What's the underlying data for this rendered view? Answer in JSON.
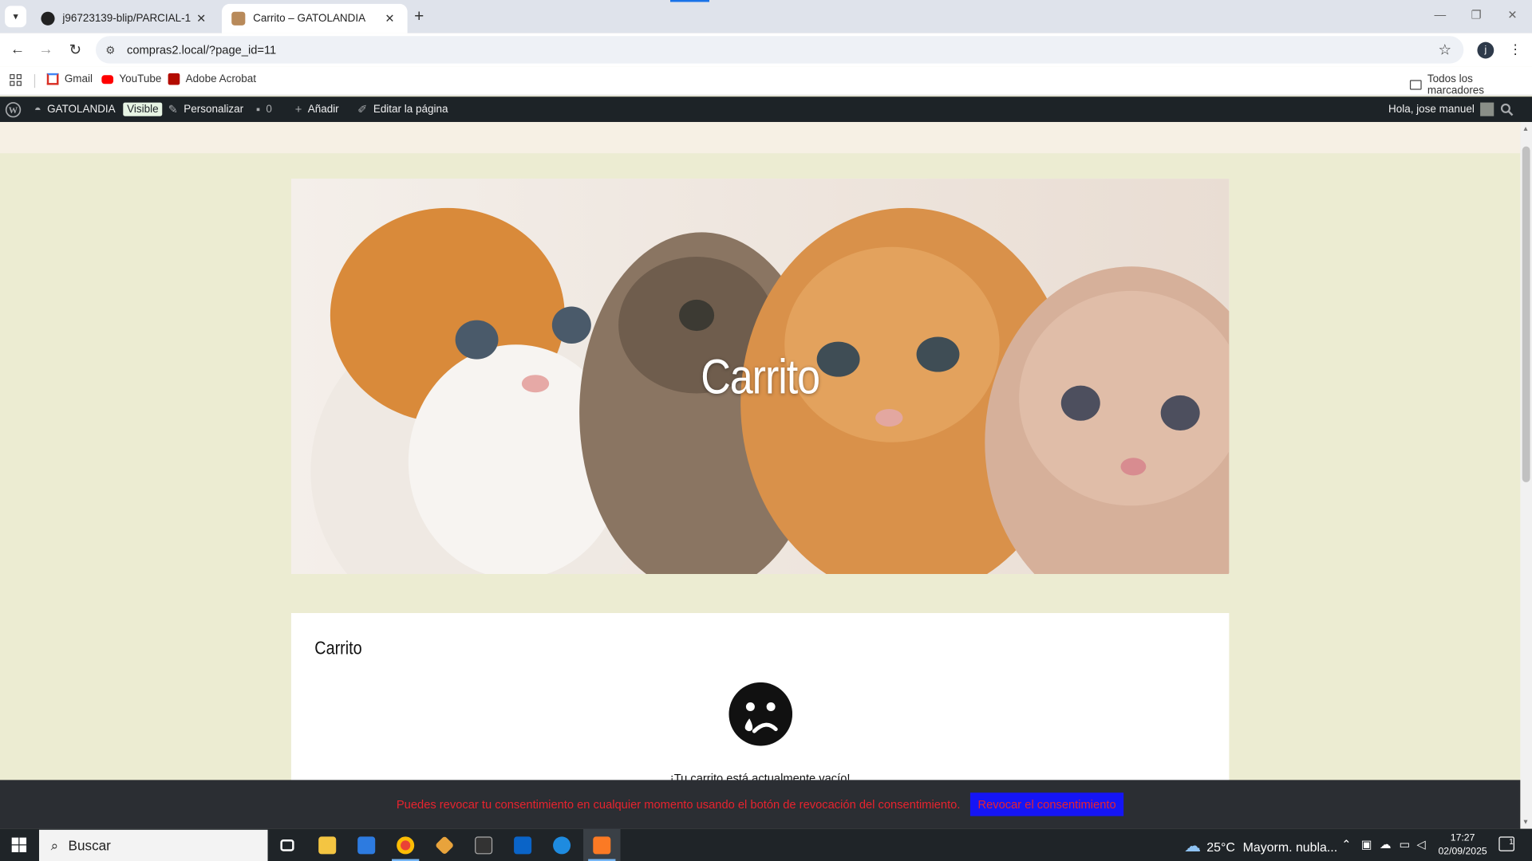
{
  "browser": {
    "tabs": [
      {
        "title": "j96723139-blip/PARCIAL-1",
        "icon": "github-icon"
      },
      {
        "title": "Carrito – GATOLANDIA",
        "icon": "site-favicon"
      }
    ],
    "url": "compras2.local/?page_id=11",
    "bookmarks": [
      {
        "label": "Gmail",
        "icon": "gmail-icon"
      },
      {
        "label": "YouTube",
        "icon": "youtube-icon"
      },
      {
        "label": "Adobe Acrobat",
        "icon": "acrobat-icon"
      }
    ],
    "all_bookmarks": "Todos los marcadores",
    "profile_initial": "j"
  },
  "adminbar": {
    "site_name": "GATOLANDIA",
    "visibility": "Visible",
    "customize": "Personalizar",
    "comments_count": "0",
    "add_new": "Añadir",
    "edit_page": "Editar la página",
    "greeting": "Hola, jose manuel"
  },
  "hero": {
    "title": "Carrito"
  },
  "cart": {
    "heading": "Carrito",
    "empty_message": "¡Tu carrito está actualmente vacío!"
  },
  "consent": {
    "message": "Puedes revocar tu consentimiento en cualquier momento usando el botón de revocación del consentimiento.",
    "button": "Revocar el consentimiento"
  },
  "taskbar": {
    "search_placeholder": "Buscar",
    "weather_temp": "25°C",
    "weather_desc": "Mayorm. nubla...",
    "time": "17:27",
    "date": "02/09/2025",
    "notification_count": "1"
  },
  "colors": {
    "page_bg": "#ececd2",
    "admin_bar": "#1d2327",
    "consent_text": "#e8232e",
    "consent_button": "#1515f5"
  }
}
